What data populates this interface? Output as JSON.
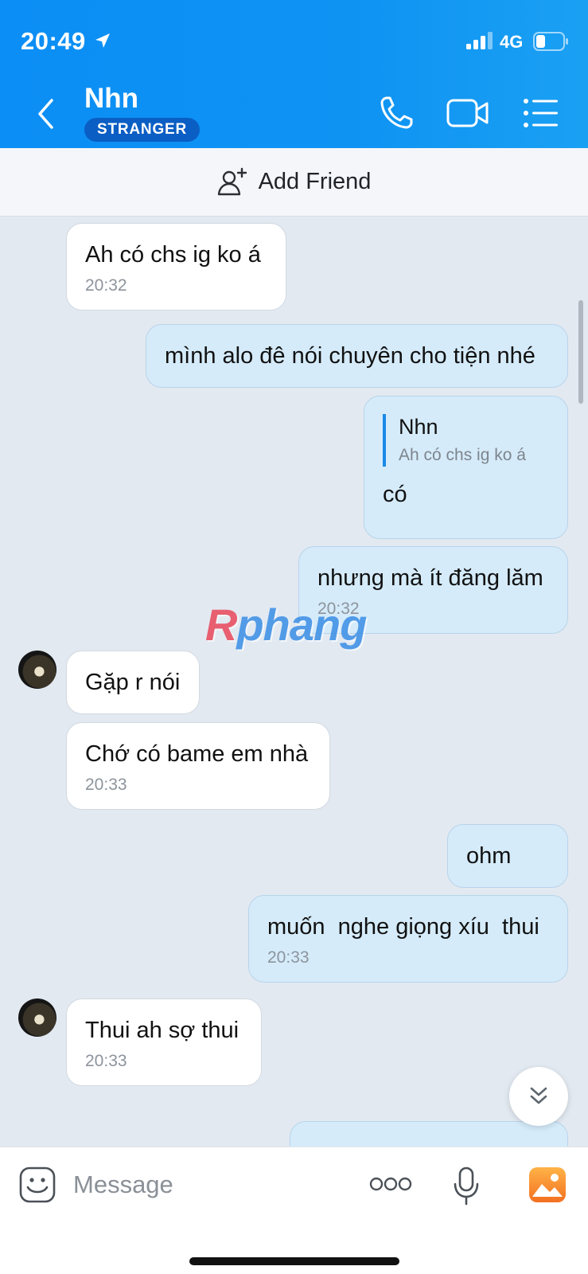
{
  "status_bar": {
    "time": "20:49",
    "network": "4G"
  },
  "header": {
    "contact_name": "Nhn",
    "badge": "STRANGER",
    "icons": [
      "back-icon",
      "phone-icon",
      "video-call-icon",
      "menu-list-icon"
    ]
  },
  "add_friend": {
    "label": "Add Friend",
    "icon": "add-user-icon"
  },
  "messages": [
    {
      "side": "in",
      "text": "Ah có chs ig ko á",
      "time": "20:32"
    },
    {
      "side": "out",
      "text": "mình alo đê nói chuyên cho tiện nhé"
    },
    {
      "side": "out",
      "quote_name": "Nhn",
      "quote_text": "Ah có chs ig ko á",
      "text": "có"
    },
    {
      "side": "out",
      "text": "nhưng mà ít đăng lăm",
      "time": "20:32"
    },
    {
      "side": "in",
      "text": "Gặp r nói"
    },
    {
      "side": "in",
      "text": "Chớ có bame em nhà",
      "time": "20:33"
    },
    {
      "side": "out",
      "text": "ohm"
    },
    {
      "side": "out",
      "text": "muốn  nghe giọng xíu  thui",
      "time": "20:33"
    },
    {
      "side": "in",
      "text": "Thui ah sợ thui",
      "time": "20:33"
    }
  ],
  "watermark": {
    "first": "R",
    "rest": "phang"
  },
  "input_bar": {
    "placeholder": "Message",
    "icons": [
      "sticker-icon",
      "more-options-icon",
      "microphone-icon",
      "photo-icon"
    ]
  },
  "colors": {
    "header_blue": "#0b8ef5",
    "outgoing_bubble": "#d5ebfa",
    "incoming_bubble": "#ffffff",
    "chat_bg": "#e2e9f1"
  }
}
